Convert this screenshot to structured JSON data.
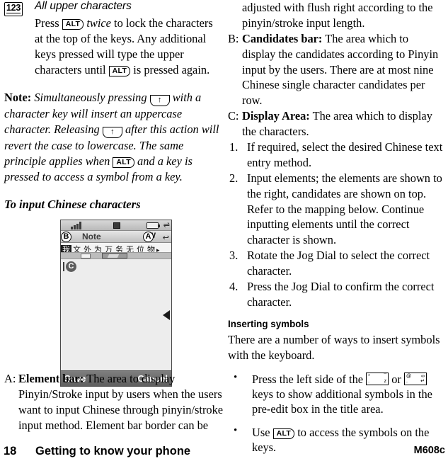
{
  "document": {
    "footer": {
      "page_number": "18",
      "chapter_title": "Getting to know your phone",
      "model": "M608c"
    }
  },
  "left_column": {
    "icon_badge": {
      "label": "123"
    },
    "section_heading": "All upper characters",
    "section_body": {
      "part1": "Press ",
      "key1": "ALT",
      "part2": " twice ",
      "part3": "to lock the characters at the top of the keys. Any additional keys pressed will type the upper characters until ",
      "key2": "ALT",
      "part4": " is pressed again."
    },
    "note": {
      "label": "Note:",
      "part1": " Simultaneously pressing ",
      "key1": "↑",
      "part2": " with a character key will insert an uppercase character. Releasing ",
      "key2": "↑",
      "part3": " after this action will revert the case to lowercase. The same principle applies when ",
      "key3": "ALT",
      "part4": " and a key is pressed to access a symbol from a key."
    },
    "subheading": "To input Chinese characters",
    "definition_a": {
      "marker": "A:",
      "term": "Element bar:",
      "text": " The area to display Pinyin/Stroke input by users when the users want to input Chinese through pinyin/stroke input method. Element bar border can be"
    }
  },
  "phone_screenshot": {
    "status_bar": {
      "signal_icon": "signal-bars-icon",
      "message_icon": "envelope-icon",
      "battery_icon": "battery-icon",
      "sync_icon": "arrows-icon"
    },
    "title_bar": {
      "title": "Note",
      "mode_indicator": "W",
      "return_icon": "return-arrow-icon"
    },
    "candidates_bar": {
      "selected": "我",
      "candidates": [
        "文",
        "外",
        "为",
        "万",
        "务",
        "无",
        "位",
        "物"
      ],
      "more_arrow": "▸"
    },
    "display_area": {
      "callout_c": "C"
    },
    "callouts": {
      "a": "A",
      "b": "B"
    },
    "softkeys": {
      "left": "Save",
      "right": "Cancel"
    }
  },
  "right_column": {
    "continuation": "adjusted with flush right according to the pinyin/stroke input length.",
    "definition_b": {
      "marker": "B:",
      "term": "Candidates bar:",
      "text": " The area which to display the candidates according to Pinyin input by the users. There are at most nine Chinese single character candidates per row."
    },
    "definition_c": {
      "marker": "C:",
      "term": "Display Area:",
      "text": " The area which to display the characters."
    },
    "steps": [
      {
        "marker": "1.",
        "text": "If required, select the desired Chinese text entry method."
      },
      {
        "marker": "2.",
        "text": "Input elements; the elements are shown to the right, candidates are shown on top. Refer to the mapping below. Continue inputting elements until the correct character is shown."
      },
      {
        "marker": "3.",
        "text": "Rotate the Jog Dial to select the correct character."
      },
      {
        "marker": "4.",
        "text": "Press the Jog Dial to confirm the correct character."
      }
    ],
    "inserting_symbols": {
      "heading": "Inserting symbols",
      "intro": "There are a number of ways to insert symbols with the keyboard.",
      "bullet1": {
        "marker": "•",
        "part1": "Press the left side of the ",
        "key1": {
          "top_left": "*",
          "top_right": "¯",
          "bottom_left": ".",
          "bottom_right": "z"
        },
        "part2": " or ",
        "key2": {
          "top_left": "@",
          "top_right": "∞",
          "bottom_left": ".",
          "bottom_right": "↵"
        },
        "part3": " keys to show additional symbols in the pre-edit box in the title area."
      },
      "bullet2": {
        "marker": "•",
        "part1": "Use ",
        "key1": "ALT",
        "part2": " to access the symbols on the keys."
      }
    }
  }
}
